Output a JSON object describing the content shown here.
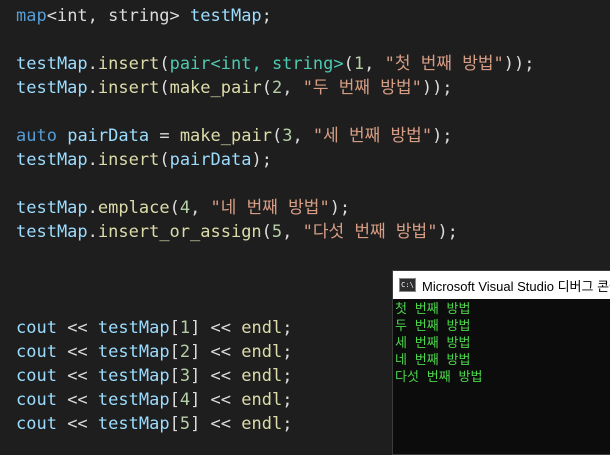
{
  "code": {
    "l1": {
      "type": "map",
      "targs": "<int, string> ",
      "var": "testMap",
      "end": ";"
    },
    "l2": {
      "obj": "testMap",
      "dot": ".",
      "fn": "insert",
      "p1": "(",
      "type": "pair",
      "targs": "<int, string>",
      "p2": "(",
      "num": "1",
      "sep": ", ",
      "str": "\"첫 번째 방법\"",
      "end": "));"
    },
    "l3": {
      "obj": "testMap",
      "dot": ".",
      "fn": "insert",
      "p1": "(",
      "fn2": "make_pair",
      "p2": "(",
      "num": "2",
      "sep": ", ",
      "str": "\"두 번째 방법\"",
      "end": "));"
    },
    "l4": {
      "kw": "auto",
      "sp": " ",
      "var": "pairData",
      "eq": " = ",
      "fn": "make_pair",
      "p1": "(",
      "num": "3",
      "sep": ", ",
      "str": "\"세 번째 방법\"",
      "end": ");"
    },
    "l5": {
      "obj": "testMap",
      "dot": ".",
      "fn": "insert",
      "p1": "(",
      "arg": "pairData",
      "end": ");"
    },
    "l6": {
      "obj": "testMap",
      "dot": ".",
      "fn": "emplace",
      "p1": "(",
      "num": "4",
      "sep": ", ",
      "str": "\"네 번째 방법\"",
      "end": ");"
    },
    "l7": {
      "obj": "testMap",
      "dot": ".",
      "fn": "insert_or_assign",
      "p1": "(",
      "num": "5",
      "sep": ", ",
      "str": "\"다섯 번째 방법\"",
      "end": ");"
    },
    "cout_lines": [
      {
        "kw": "cout",
        "op": " << ",
        "obj": "testMap",
        "lb": "[",
        "idx": "1",
        "rb": "]",
        "op2": " << ",
        "endl": "endl",
        "end": ";"
      },
      {
        "kw": "cout",
        "op": " << ",
        "obj": "testMap",
        "lb": "[",
        "idx": "2",
        "rb": "]",
        "op2": " << ",
        "endl": "endl",
        "end": ";"
      },
      {
        "kw": "cout",
        "op": " << ",
        "obj": "testMap",
        "lb": "[",
        "idx": "3",
        "rb": "]",
        "op2": " << ",
        "endl": "endl",
        "end": ";"
      },
      {
        "kw": "cout",
        "op": " << ",
        "obj": "testMap",
        "lb": "[",
        "idx": "4",
        "rb": "]",
        "op2": " << ",
        "endl": "endl",
        "end": ";"
      },
      {
        "kw": "cout",
        "op": " << ",
        "obj": "testMap",
        "lb": "[",
        "idx": "5",
        "rb": "]",
        "op2": " << ",
        "endl": "endl",
        "end": ";"
      }
    ]
  },
  "console": {
    "icon_text": "C:\\",
    "title": "Microsoft Visual Studio 디버그 콘솔",
    "output": [
      "첫 번째 방법",
      "두 번째 방법",
      "세 번째 방법",
      "네 번째 방법",
      "다섯 번째 방법"
    ]
  },
  "colors": {
    "editor_bg": "#1e1e1e",
    "keyword": "#569cd6",
    "type": "#4ec9b0",
    "variable": "#9cdcfe",
    "function": "#dcdcaa",
    "number": "#b5cea8",
    "string": "#d69d85",
    "console_text": "#4cd64c"
  }
}
